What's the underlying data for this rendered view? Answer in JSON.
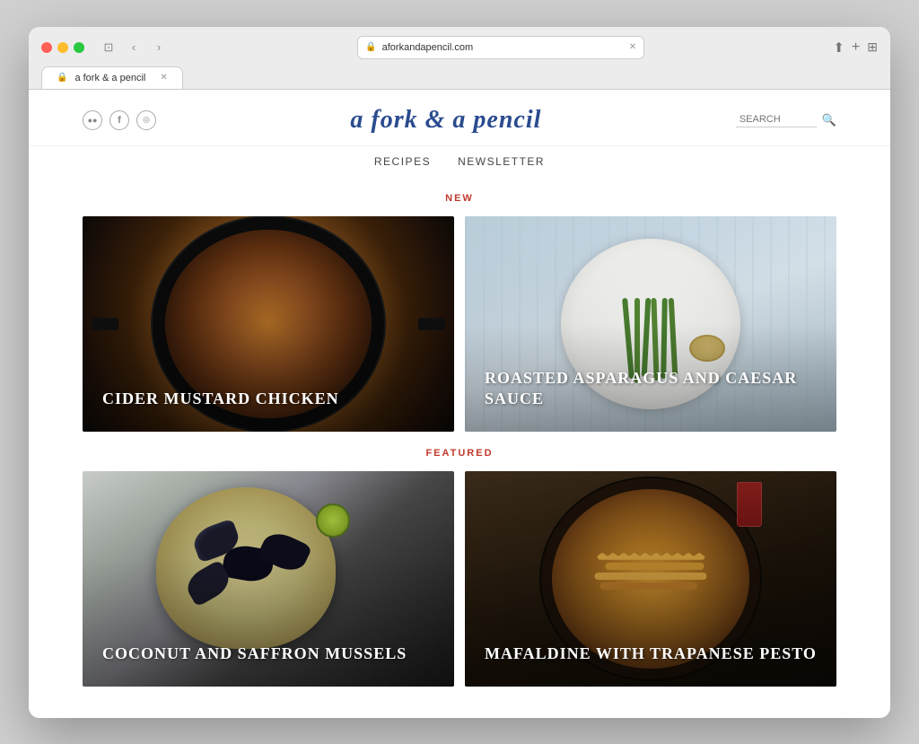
{
  "browser": {
    "url": "aforkandapencil.com",
    "tab_title": "a fork & a pencil",
    "back_icon": "‹",
    "forward_icon": "›",
    "sidebar_icon": "⊞",
    "share_icon": "↑",
    "add_tab_icon": "+",
    "grid_icon": "⊞"
  },
  "header": {
    "title": "a fork & a pencil",
    "search_placeholder": "SEARCH",
    "social_icons": [
      "◁",
      "f",
      "◯"
    ]
  },
  "nav": {
    "items": [
      {
        "label": "RECIPES"
      },
      {
        "label": "NEWSLETTER"
      }
    ]
  },
  "sections": {
    "new": {
      "label": "NEW",
      "recipes": [
        {
          "id": "chicken",
          "title": "CIDER MUSTARD CHICKEN",
          "bg_class": "chicken"
        },
        {
          "id": "asparagus",
          "title": "ROASTED ASPARAGUS AND CAESAR SAUCE",
          "bg_class": "asparagus"
        }
      ]
    },
    "featured": {
      "label": "FEATURED",
      "recipes": [
        {
          "id": "mussels",
          "title": "COCONUT AND SAFFRON MUSSELS",
          "bg_class": "mussels"
        },
        {
          "id": "pasta",
          "title": "MAFALDINE WITH TRAPANESE PESTO",
          "bg_class": "pasta"
        }
      ]
    }
  }
}
